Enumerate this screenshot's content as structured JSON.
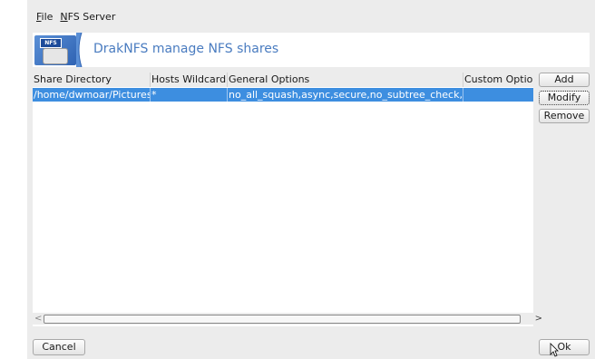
{
  "menubar": {
    "file": {
      "mnemonic": "F",
      "rest": "ile"
    },
    "nfs_server": {
      "mnemonic": "N",
      "rest": "FS Server"
    }
  },
  "banner": {
    "logo_tag": "NFS",
    "title": "DrakNFS manage NFS shares"
  },
  "table": {
    "headers": [
      "Share Directory",
      "Hosts Wildcard",
      "General Options",
      "Custom Optio"
    ],
    "rows": [
      [
        "/home/dwmoar/Pictures",
        "*",
        "no_all_squash,async,secure,no_subtree_check,ro",
        ""
      ]
    ],
    "selected_row": 0
  },
  "side_buttons": {
    "add": "Add",
    "modify": "Modify",
    "remove": "Remove"
  },
  "bottom_buttons": {
    "cancel": "Cancel",
    "ok": "Ok"
  },
  "colors": {
    "selection": "#3d8ee0",
    "banner_title": "#4a7cc0"
  }
}
